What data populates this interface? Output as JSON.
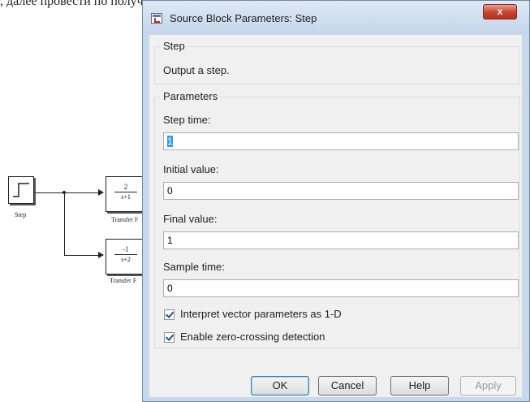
{
  "background_text": "               , далее                          провести по                           получить",
  "model": {
    "step_block_label": "Step",
    "tf1": {
      "num": "2",
      "den": "s+1",
      "label": "Transfer F"
    },
    "tf2": {
      "num": "-1",
      "den": "s+2",
      "label": "Transfer F"
    }
  },
  "dialog": {
    "title": "Source Block Parameters: Step",
    "close_label": "x",
    "block_group_title": "Step",
    "description": "Output a step.",
    "parameters_group_title": "Parameters",
    "step_time": {
      "label": "Step time:",
      "value": "1"
    },
    "initial_value": {
      "label": "Initial value:",
      "value": "0"
    },
    "final_value": {
      "label": "Final value:",
      "value": "1"
    },
    "sample_time": {
      "label": "Sample time:",
      "value": "0"
    },
    "checkboxes": [
      {
        "label": "Interpret vector parameters as 1-D",
        "checked": true
      },
      {
        "label": "Enable zero-crossing detection",
        "checked": true
      }
    ],
    "buttons": {
      "ok": "OK",
      "cancel": "Cancel",
      "help": "Help",
      "apply": "Apply"
    }
  }
}
